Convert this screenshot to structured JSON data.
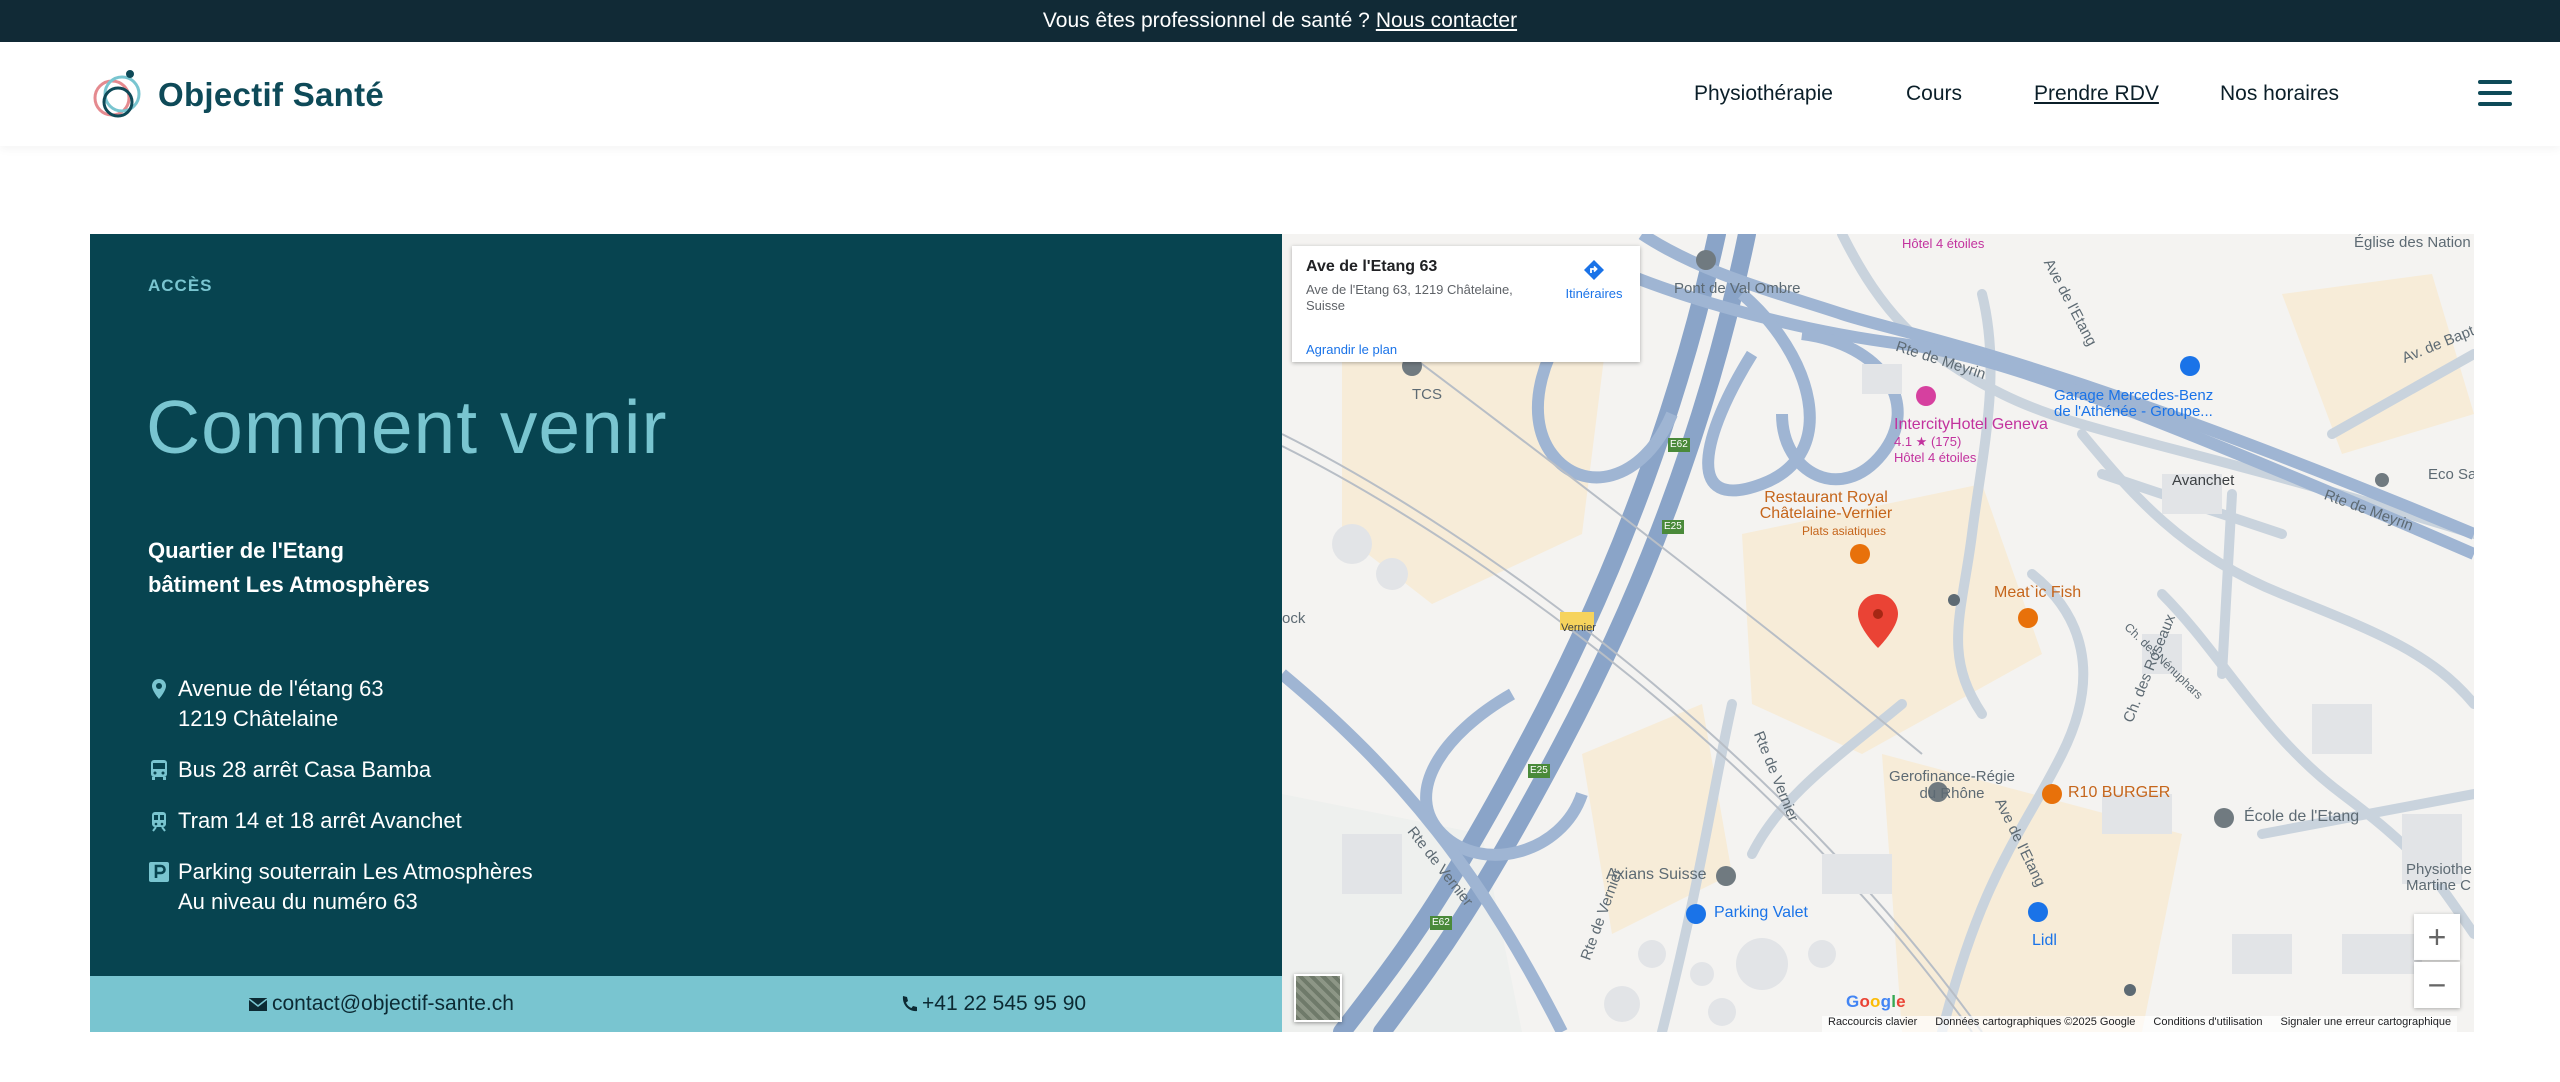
{
  "topbar": {
    "question": "Vous êtes professionnel de santé ?",
    "contact_link": "Nous contacter"
  },
  "header": {
    "logo_text": "Objectif Santé",
    "nav": [
      {
        "label": "Physiothérapie",
        "active": false
      },
      {
        "label": "Cours",
        "active": false
      },
      {
        "label": "Prendre RDV",
        "active": true
      },
      {
        "label": "Nos horaires",
        "active": false
      }
    ],
    "menu_icon": "hamburger-icon"
  },
  "access": {
    "eyebrow": "ACCÈS",
    "title": "Comment venir",
    "district_line1": "Quartier de l'Etang",
    "district_line2": "bâtiment Les Atmosphères",
    "items": [
      {
        "icon": "map-pin-icon",
        "line1": "Avenue de l'étang 63",
        "line2": "1219 Châtelaine"
      },
      {
        "icon": "bus-icon",
        "line1": "Bus 28 arrêt Casa Bamba",
        "line2": ""
      },
      {
        "icon": "tram-icon",
        "line1": "Tram 14 et 18 arrêt Avanchet",
        "line2": ""
      },
      {
        "icon": "parking-icon",
        "line1": "Parking souterrain Les Atmosphères",
        "line2": "Au niveau du numéro 63"
      }
    ],
    "email": "contact@objectif-sante.ch",
    "phone": "+41 22 545 95 90"
  },
  "map": {
    "infobox": {
      "title": "Ave de l'Etang 63",
      "address": "Ave de l'Etang 63, 1219 Châtelaine, Suisse",
      "enlarge": "Agrandir le plan",
      "directions": "Itinéraires"
    },
    "labels": {
      "hotel_top": "Hôtel 4 étoiles",
      "church": "Église des Nation",
      "pont": "Pont de Val Ombre",
      "tcs": "TCS",
      "rte_meyrin_1": "Rte de Meyrin",
      "rte_meyrin_2": "Rte de Meyrin",
      "ave_etang_top": "Ave de l'Etang",
      "ave_bap": "Av. de Bapt",
      "garage": "Garage Mercedes-Benz de l'Athénée - Groupe...",
      "hotel_name": "IntercityHotel Geneva",
      "hotel_rating": "4.1 ★ (175)",
      "hotel_class": "Hôtel 4 étoiles",
      "avanchet": "Avanchet",
      "eco": "Eco Sa",
      "restaurant": "Restaurant Royal Châtelaine-Vernier",
      "restaurant_type": "Plats asiatiques",
      "meat": "Meat`ic Fish",
      "rock": "ock",
      "vernier": "Vernier",
      "ch_roseaux": "Ch. des Roseaux",
      "nenuphars": "Ch. des Nénuphars",
      "rte_vernier": "Rte de Vernier",
      "rte_vernier_2": "Rte de Vernier",
      "rte_vernier_3": "Rte de Vernier",
      "gerofinance": "Gerofinance-Régie du Rhône",
      "r10": "R10 BURGER",
      "ecole": "École de l'Etang",
      "ave_etang_bottom": "Ave de l'Etang",
      "axians": "Axians Suisse",
      "parking_valet": "Parking Valet",
      "lidl": "Lidl",
      "physio": "Physiothe Martine C",
      "e62_1": "E62",
      "e25_1": "E25",
      "e25_2": "E25",
      "e62_2": "E62"
    },
    "google_logo": "Google",
    "attribution": [
      "Raccourcis clavier",
      "Données cartographiques ©2025 Google",
      "Conditions d'utilisation",
      "Signaler une erreur cartographique"
    ],
    "zoom_in": "+",
    "zoom_out": "−"
  }
}
